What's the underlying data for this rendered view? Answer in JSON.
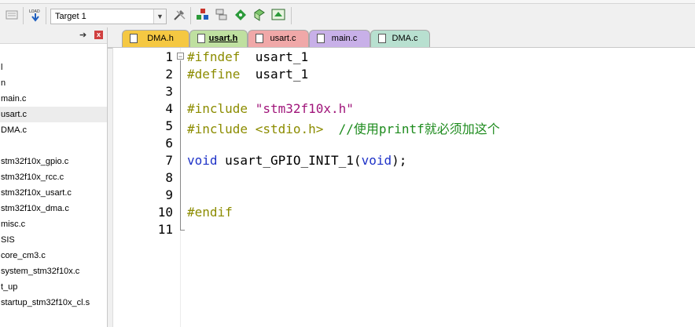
{
  "toolbar": {
    "target_value": "Target 1",
    "colors": {
      "build_green": "#2b9a3a",
      "build_red": "#c8342c"
    }
  },
  "project": {
    "items": [
      {
        "label": "l"
      },
      {
        "label": "n"
      },
      {
        "label": "main.c"
      },
      {
        "label": "usart.c",
        "selected": true
      },
      {
        "label": "DMA.c"
      },
      {
        "label": "stm32f10x_gpio.c"
      },
      {
        "label": "stm32f10x_rcc.c"
      },
      {
        "label": "stm32f10x_usart.c"
      },
      {
        "label": "stm32f10x_dma.c"
      },
      {
        "label": "misc.c"
      },
      {
        "label": "SIS"
      },
      {
        "label": "core_cm3.c"
      },
      {
        "label": "system_stm32f10x.c"
      },
      {
        "label": "t_up"
      },
      {
        "label": "startup_stm32f10x_cl.s"
      }
    ]
  },
  "tabs": [
    {
      "label": "DMA.h",
      "color": "#f5c842"
    },
    {
      "label": "usart.h",
      "color": "#bfe0a0",
      "active": true
    },
    {
      "label": "usart.c",
      "color": "#f0a8a8"
    },
    {
      "label": "main.c",
      "color": "#c8b0e8"
    },
    {
      "label": "DMA.c",
      "color": "#b8e0d0"
    }
  ],
  "editor": {
    "line_numbers": [
      "1",
      "2",
      "3",
      "4",
      "5",
      "6",
      "7",
      "8",
      "9",
      "10",
      "11"
    ],
    "lines": [
      [
        {
          "t": "#ifndef  ",
          "c": "pre"
        },
        {
          "t": "usart_1",
          "c": "plain"
        }
      ],
      [
        {
          "t": "#define  ",
          "c": "pre"
        },
        {
          "t": "usart_1",
          "c": "plain"
        }
      ],
      [],
      [
        {
          "t": "#include ",
          "c": "pre"
        },
        {
          "t": "\"stm32f10x.h\"",
          "c": "str"
        }
      ],
      [
        {
          "t": "#include <stdio.h>  ",
          "c": "pre"
        },
        {
          "t": "//使用printf就必须加这个",
          "c": "com"
        }
      ],
      [],
      [
        {
          "t": "void",
          "c": "kw"
        },
        {
          "t": " usart_GPIO_INIT_1(",
          "c": "plain"
        },
        {
          "t": "void",
          "c": "kw"
        },
        {
          "t": ");",
          "c": "plain"
        }
      ],
      [],
      [],
      [
        {
          "t": "#endif",
          "c": "pre"
        }
      ],
      []
    ]
  }
}
